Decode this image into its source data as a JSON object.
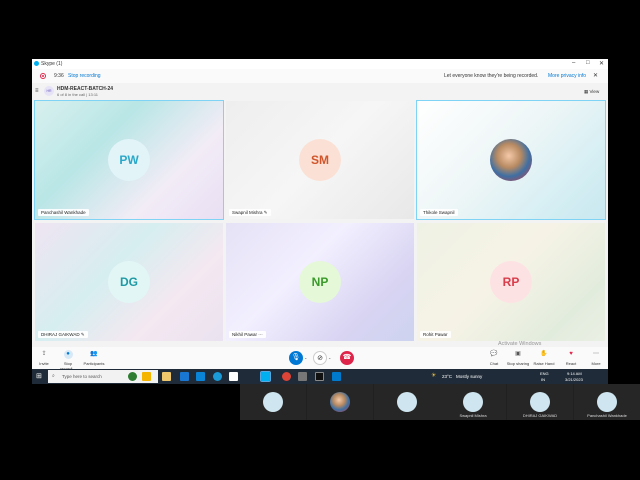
{
  "window": {
    "title": "Skype (1)",
    "controls": [
      "–",
      "□",
      "✕"
    ]
  },
  "recording": {
    "time": "9:36",
    "stop_label": "Stop recording",
    "notice": "Let everyone know they're being recorded.",
    "privacy_link": "More privacy info",
    "close": "✕"
  },
  "call": {
    "title": "HDM-REACT-BATCH-24",
    "badge": "HR",
    "subtitle": "6 of 8 in the call | 13:11",
    "view_label": "View"
  },
  "participants": [
    {
      "initials": "PW",
      "name": "Panchashil Wankhade",
      "avatar_bg": "#e2f4f8",
      "initials_color": "#2aa8c9",
      "active": true
    },
    {
      "initials": "SM",
      "name": "Swapnil Mishra",
      "avatar_bg": "#fbe1d5",
      "initials_color": "#d1552a",
      "active": false
    },
    {
      "initials": "",
      "name": "Thikole Swapnil",
      "avatar_bg": "photo",
      "initials_color": "#ffffff",
      "active": true
    },
    {
      "initials": "DG",
      "name": "DHIRAJ GAIKWAD",
      "avatar_bg": "#e2f6f6",
      "initials_color": "#1f9aa4",
      "active": false
    },
    {
      "initials": "NP",
      "name": "Nikhil Pawar",
      "avatar_bg": "#e5f8d8",
      "initials_color": "#3a9a2a",
      "active": false
    },
    {
      "initials": "RP",
      "name": "Rohit Pawar",
      "avatar_bg": "#fde2e4",
      "initials_color": "#d93c4a",
      "active": false
    }
  ],
  "toolbar": {
    "invite": "Invite",
    "stop_recording": "Stop recordi...",
    "participants": "Participants",
    "chat": "Chat",
    "stop_sharing": "Stop sharing",
    "raise_hand": "Raise Hand",
    "react": "React",
    "more": "More"
  },
  "watermark": {
    "line1": "Activate Windows",
    "line2": "Go to Settings to activate Windows."
  },
  "taskbar": {
    "search_placeholder": "Type here to search",
    "weather_temp": "23°C",
    "weather_text": "Mostly sunny",
    "lang": "ENG",
    "region": "IN",
    "time": "9:14 AM",
    "date": "3/21/2023"
  },
  "thumbnails": [
    {
      "label": ""
    },
    {
      "label": ""
    },
    {
      "label": ""
    },
    {
      "label": "Swapnil Mishra"
    },
    {
      "label": "DHIRAJ GAIKWAD"
    },
    {
      "label": "Panchashil Wankhade"
    }
  ],
  "colors": {
    "accent": "#0078d4",
    "end_call": "#e0254a",
    "active_border": "#7fd3f5"
  },
  "icons": {
    "mic": "microphone-icon",
    "camera": "camera-off-icon",
    "hangup": "hangup-icon"
  }
}
